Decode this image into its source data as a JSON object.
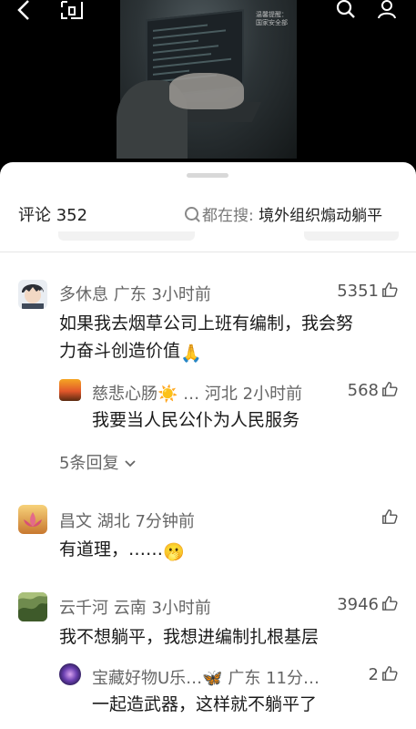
{
  "topbar": {
    "back_icon": "chevron-left-icon",
    "cast_icon": "cast-icon",
    "search_icon": "search-icon",
    "profile_icon": "person-icon"
  },
  "video": {
    "watermark_line1": "温馨提醒：",
    "watermark_line2": "国家安全部"
  },
  "comments_header": {
    "title": "评论",
    "count": "352",
    "search_prefix": "都在搜:",
    "search_topic": "境外组织煽动躺平"
  },
  "comments": [
    {
      "user": "多休息",
      "location": "广东",
      "time": "3小时前",
      "likes": "5351",
      "text_line1": "如果我去烟草公司上班有编制，我会努",
      "text_line2": "力奋斗创造价值",
      "text_emoji": "🙏",
      "reply": {
        "user": "慈悲心肠",
        "user_emoji": "☀️",
        "ellipsis": "…",
        "location": "河北",
        "time": "2小时前",
        "likes": "568",
        "text": "我要当人民公仆为人民服务"
      },
      "more_replies": "5条回复"
    },
    {
      "user": "昌文",
      "location": "湖北",
      "time": "7分钟前",
      "likes": "",
      "text": "有道理，……",
      "text_emoji": "🫢"
    },
    {
      "user": "云千河",
      "location": "云南",
      "time": "3小时前",
      "likes": "3946",
      "text": "我不想躺平，我想进编制扎根基层",
      "reply": {
        "user": "宝藏好物U乐…",
        "user_emoji": "🦋",
        "location": "广东",
        "time": "11分…",
        "likes": "2",
        "text": "一起造武器，这样就不躺平了"
      }
    }
  ]
}
